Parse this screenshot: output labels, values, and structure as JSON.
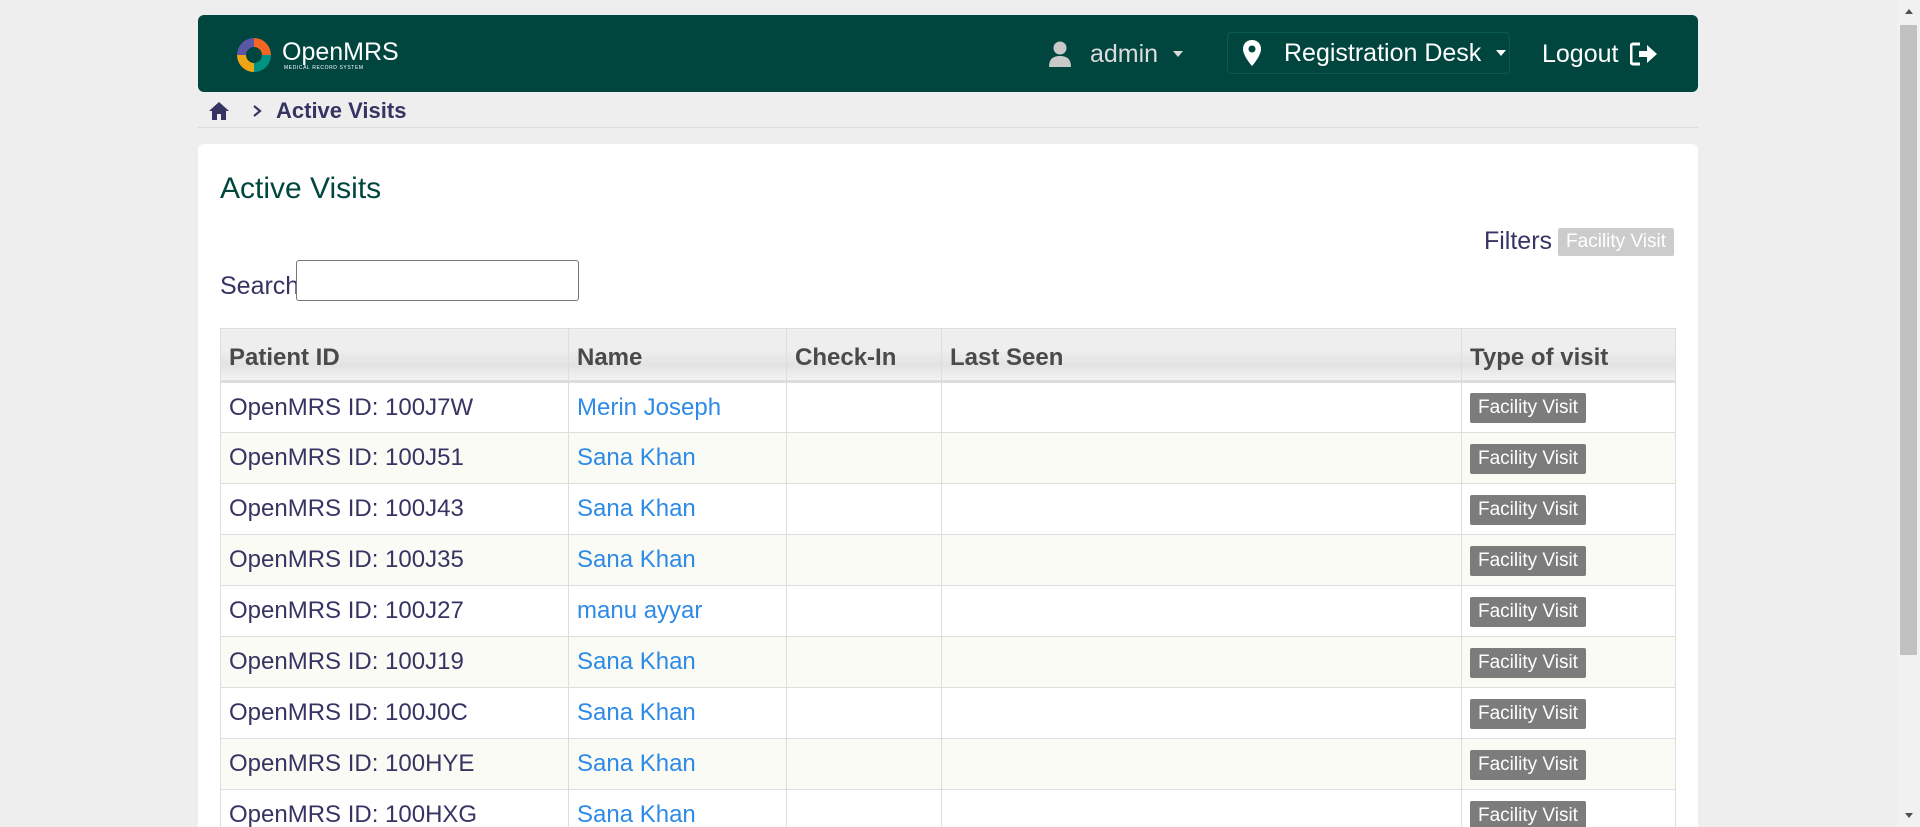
{
  "header": {
    "app_name": "OpenMRS",
    "app_subtitle": "MEDICAL RECORD SYSTEM",
    "user": "admin",
    "location": "Registration Desk",
    "logout": "Logout"
  },
  "breadcrumb": {
    "current": "Active Visits"
  },
  "main": {
    "title": "Active Visits",
    "filters_label": "Filters",
    "filter_chip": "Facility Visit",
    "search_label": "Search",
    "search_value": ""
  },
  "table": {
    "headers": [
      "Patient ID",
      "Name",
      "Check-In",
      "Last Seen",
      "Type of visit"
    ],
    "rows": [
      {
        "id": "OpenMRS ID: 100J7W",
        "name": "Merin Joseph",
        "check_in": "",
        "last_seen": "",
        "type": "Facility Visit"
      },
      {
        "id": "OpenMRS ID: 100J51",
        "name": "Sana Khan",
        "check_in": "",
        "last_seen": "",
        "type": "Facility Visit"
      },
      {
        "id": "OpenMRS ID: 100J43",
        "name": "Sana Khan",
        "check_in": "",
        "last_seen": "",
        "type": "Facility Visit"
      },
      {
        "id": "OpenMRS ID: 100J35",
        "name": "Sana Khan",
        "check_in": "",
        "last_seen": "",
        "type": "Facility Visit"
      },
      {
        "id": "OpenMRS ID: 100J27",
        "name": "manu ayyar",
        "check_in": "",
        "last_seen": "",
        "type": "Facility Visit"
      },
      {
        "id": "OpenMRS ID: 100J19",
        "name": "Sana Khan",
        "check_in": "",
        "last_seen": "",
        "type": "Facility Visit"
      },
      {
        "id": "OpenMRS ID: 100J0C",
        "name": "Sana Khan",
        "check_in": "",
        "last_seen": "",
        "type": "Facility Visit"
      },
      {
        "id": "OpenMRS ID: 100HYE",
        "name": "Sana Khan",
        "check_in": "",
        "last_seen": "",
        "type": "Facility Visit"
      },
      {
        "id": "OpenMRS ID: 100HXG",
        "name": "Sana Khan",
        "check_in": "",
        "last_seen": "",
        "type": "Facility Visit"
      }
    ]
  },
  "colors": {
    "header_bg": "#00463f",
    "link": "#2d8ae6",
    "badge": "#7c7c7c",
    "filter_chip": "#cccccc",
    "title": "#00463f"
  },
  "icons": {
    "user": "user-icon",
    "location": "map-pin-icon",
    "logout": "logout-icon",
    "home": "home-icon"
  }
}
